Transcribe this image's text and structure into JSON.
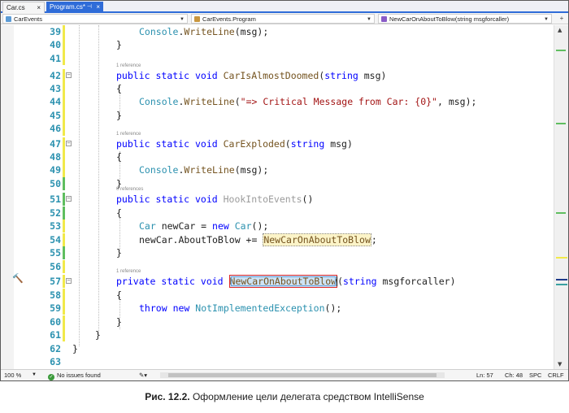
{
  "tabs": [
    {
      "label": "Car.cs",
      "active": false
    },
    {
      "label": "Program.cs*",
      "active": true
    }
  ],
  "navbar": {
    "project": "CarEvents",
    "class": "CarEvents.Program",
    "member": "NewCarOnAboutToBlow(string msgforcaller)"
  },
  "references": {
    "one": "1 reference",
    "zero": "0 references"
  },
  "code_lines": [
    {
      "n": "39",
      "change": "yellow"
    },
    {
      "n": "40",
      "change": "yellow"
    },
    {
      "n": "41",
      "change": "yellow"
    },
    {
      "n": "42",
      "change": "yellow",
      "ref": "1 reference"
    },
    {
      "n": "43",
      "change": "yellow"
    },
    {
      "n": "44",
      "change": "yellow"
    },
    {
      "n": "45",
      "change": "yellow"
    },
    {
      "n": "46",
      "change": "yellow"
    },
    {
      "n": "47",
      "change": "yellow",
      "ref": "1 reference"
    },
    {
      "n": "48",
      "change": "yellow"
    },
    {
      "n": "49",
      "change": "yellow"
    },
    {
      "n": "50",
      "change": "green"
    },
    {
      "n": "51",
      "change": "green",
      "ref": "0 references"
    },
    {
      "n": "52",
      "change": "green"
    },
    {
      "n": "53",
      "change": "yellow"
    },
    {
      "n": "54",
      "change": "yellow"
    },
    {
      "n": "55",
      "change": "green"
    },
    {
      "n": "56",
      "change": "yellow"
    },
    {
      "n": "57",
      "change": "yellow",
      "ref": "1 reference"
    },
    {
      "n": "58",
      "change": "yellow"
    },
    {
      "n": "59",
      "change": "yellow"
    },
    {
      "n": "60",
      "change": "yellow"
    },
    {
      "n": "61",
      "change": "yellow"
    },
    {
      "n": "62",
      "change": "none"
    },
    {
      "n": "63",
      "change": "none"
    }
  ],
  "code": {
    "l39": [
      "Console",
      ".",
      "WriteLine",
      "(msg);"
    ],
    "l40": "}",
    "l42": [
      "public",
      "static",
      "void",
      "CarIsAlmostDoomed",
      "(",
      "string",
      " msg)"
    ],
    "l43": "{",
    "l44": [
      "Console",
      ".",
      "WriteLine",
      "(",
      "\"=> Critical Message from Car: {0}\"",
      ", msg);"
    ],
    "l45": "}",
    "l47": [
      "public",
      "static",
      "void",
      "CarExploded",
      "(",
      "string",
      " msg)"
    ],
    "l48": "{",
    "l49": [
      "Console",
      ".",
      "WriteLine",
      "(msg);"
    ],
    "l50": "}",
    "l51": [
      "public",
      "static",
      "void",
      "HookIntoEvents",
      "()"
    ],
    "l52": "{",
    "l53": [
      "Car",
      " newCar = ",
      "new",
      " ",
      "Car",
      "();"
    ],
    "l54": [
      "newCar.AboutToBlow += ",
      "NewCarOnAboutToBlow",
      ";"
    ],
    "l55": "}",
    "l57": [
      "private",
      "static",
      "void",
      "NewCarOnAboutToBlow",
      "(",
      "string",
      " msgforcaller)"
    ],
    "l58": "{",
    "l59": [
      "throw",
      "new",
      "NotImplementedException",
      "();"
    ],
    "l60": "}",
    "l61": "}",
    "l62": "}"
  },
  "status": {
    "zoom": "100 %",
    "issues": "No issues found",
    "ln": "Ln: 57",
    "ch": "Ch: 48",
    "spc": "SPC",
    "crlf": "CRLF"
  },
  "caption": {
    "label": "Рис. 12.2.",
    "text": "Оформление цели делегата средством IntelliSense"
  },
  "colors": {
    "keyword": "#0000ff",
    "type": "#2b91af",
    "string": "#a31515",
    "method": "#74531f",
    "line_number": "#2b91af",
    "change_saved": "#5fbe5f",
    "change_unsaved": "#f1e94a",
    "tab_active": "#2f6cd8"
  }
}
